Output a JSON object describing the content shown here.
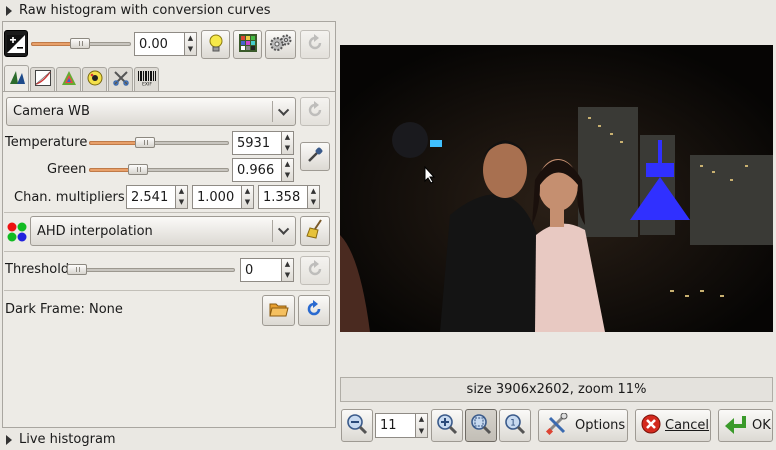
{
  "header": {
    "raw_histogram_label": "Raw histogram with conversion curves"
  },
  "exposure": {
    "value": "0.00",
    "level_fraction": 0.48
  },
  "tabs": [
    {
      "icon": "white-balance-icon",
      "active": true
    },
    {
      "icon": "curve-icon"
    },
    {
      "icon": "color-icon"
    },
    {
      "icon": "lens-icon"
    },
    {
      "icon": "crop-icon"
    },
    {
      "icon": "exif-icon"
    }
  ],
  "wb": {
    "preset": "Camera WB",
    "temperature_label": "Temperature",
    "temperature_value": "5931",
    "green_label": "Green",
    "green_value": "0.966",
    "multipliers_label": "Chan. multipliers:",
    "multipliers": [
      "2.541",
      "1.000",
      "1.358"
    ]
  },
  "interpolation": {
    "selected": "AHD interpolation"
  },
  "threshold": {
    "label": "Threshold",
    "value": "0"
  },
  "dark_frame": {
    "label": "Dark Frame: None"
  },
  "footer": {
    "live_histogram_label": "Live histogram"
  },
  "status": {
    "text": "size 3906x2602, zoom 11%"
  },
  "zoom": {
    "value": "11"
  },
  "buttons": {
    "options": "Options",
    "cancel": "Cancel",
    "ok": "OK"
  }
}
